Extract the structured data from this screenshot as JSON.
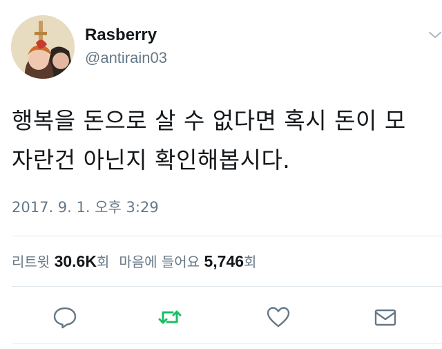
{
  "user": {
    "display_name": "Rasberry",
    "handle": "@antirain03"
  },
  "tweet": {
    "text": "행복을 돈으로 살 수 없다면 혹시 돈이 모\n자란건 아닌지 확인해봅시다.",
    "timestamp": "2017. 9. 1. 오후 3:29"
  },
  "stats": {
    "retweets_label": "리트윗",
    "retweets_count": "30.6K",
    "retweets_unit": "회",
    "likes_label": "마음에 들어요",
    "likes_count": "5,746",
    "likes_unit": "회"
  },
  "icons": {
    "caret": "chevron-down-icon",
    "reply": "reply-icon",
    "retweet": "retweet-icon",
    "like": "heart-icon",
    "dm": "envelope-icon"
  },
  "colors": {
    "text": "#14171a",
    "secondary": "#657786",
    "retweet_active": "#17bf63",
    "divider": "#e1e8ed"
  }
}
